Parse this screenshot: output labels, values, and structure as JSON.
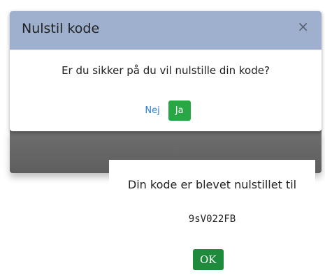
{
  "confirm_dialog": {
    "title": "Nulstil kode",
    "close_glyph": "×",
    "question": "Er du sikker på du vil nulstille din kode?",
    "no_label": "Nej",
    "yes_label": "Ja",
    "header_color": "#9fb0cf",
    "yes_color": "#29a745"
  },
  "result_panel": {
    "message": "Din kode er blevet nulstillet til",
    "new_code": "9sV022FB",
    "ok_label": "OK",
    "ok_color": "#1e8a3c"
  }
}
